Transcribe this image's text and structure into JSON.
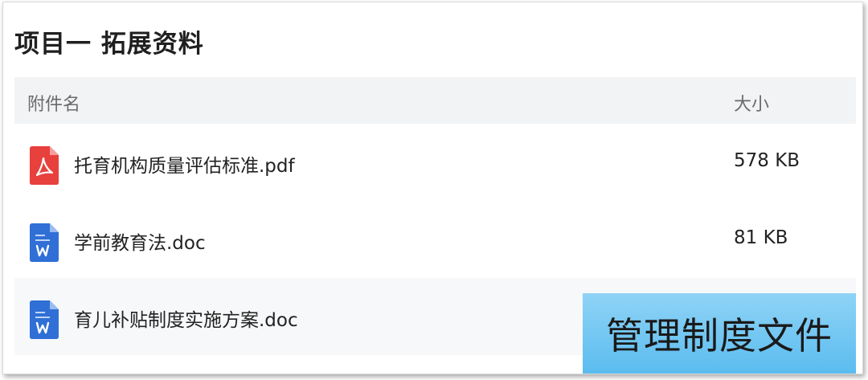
{
  "panel": {
    "title": "项目一 拓展资料"
  },
  "table": {
    "headers": {
      "name": "附件名",
      "size": "大小"
    },
    "rows": [
      {
        "name": "托育机构质量评估标准.pdf",
        "size": "578 KB",
        "icon": "pdf-file-icon"
      },
      {
        "name": "学前教育法.doc",
        "size": "81 KB",
        "icon": "word-doc-icon"
      },
      {
        "name": "育儿补贴制度实施方案.doc",
        "size": "",
        "icon": "word-doc-icon"
      }
    ]
  },
  "overlay": {
    "label": "管理制度文件"
  },
  "colors": {
    "pdf": "#e8403d",
    "word": "#2f6fd6",
    "overlay": "#7dccf3",
    "header_bg": "#f2f3f5"
  }
}
